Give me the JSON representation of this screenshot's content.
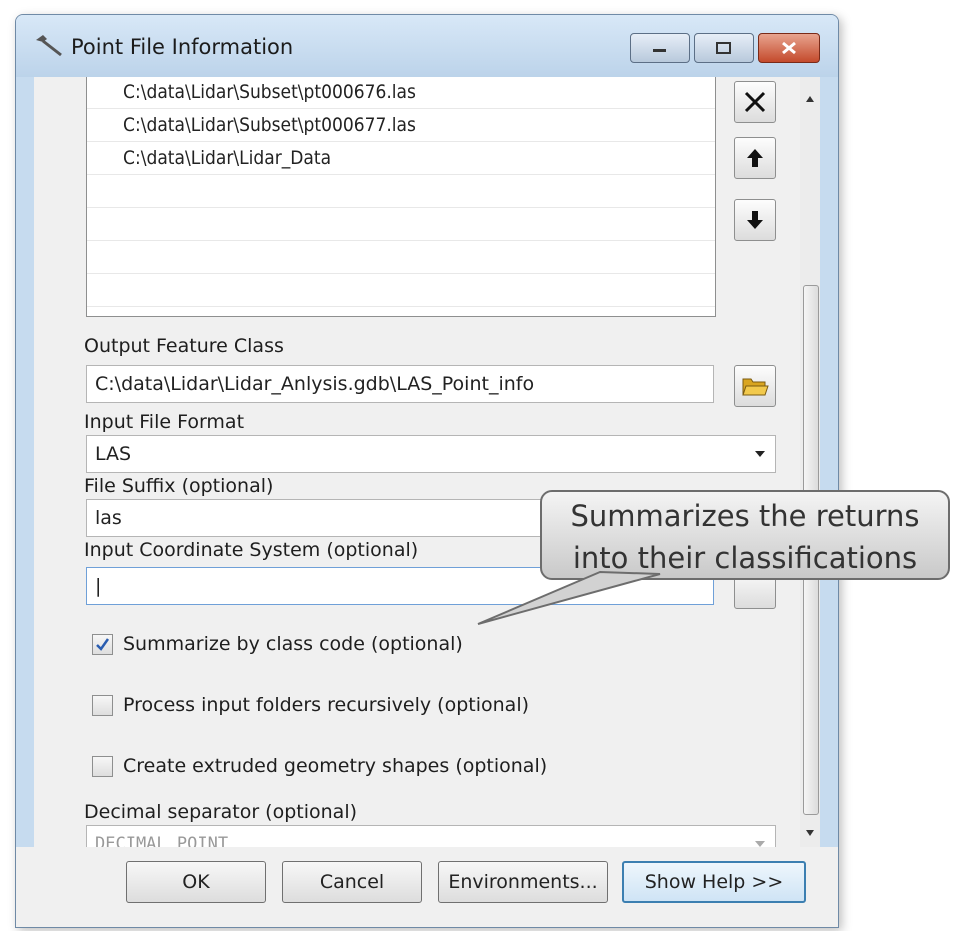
{
  "window": {
    "title": "Point File Information"
  },
  "input_files": {
    "items": [
      "C:\\data\\Lidar\\Subset\\pt000676.las",
      "C:\\data\\Lidar\\Subset\\pt000677.las",
      "C:\\data\\Lidar\\Lidar_Data"
    ]
  },
  "output_feature_class": {
    "label": "Output Feature Class",
    "value": "C:\\data\\Lidar\\Lidar_Anlysis.gdb\\LAS_Point_info"
  },
  "input_file_format": {
    "label": "Input File Format",
    "value": "LAS"
  },
  "file_suffix": {
    "label": "File Suffix (optional)",
    "value": "las"
  },
  "input_coordinate_system": {
    "label": "Input Coordinate System (optional)",
    "value": "|"
  },
  "checkboxes": [
    {
      "label": "Summarize by class code (optional)",
      "checked": true
    },
    {
      "label": "Process input folders recursively (optional)",
      "checked": false
    },
    {
      "label": "Create extruded geometry shapes (optional)",
      "checked": false
    }
  ],
  "decimal_separator": {
    "label": "Decimal separator (optional)",
    "value": "DECIMAL_POINT"
  },
  "buttons": {
    "ok": "OK",
    "cancel": "Cancel",
    "environments": "Environments...",
    "show_help": "Show Help >>"
  },
  "callout": {
    "line1": "Summarizes the returns",
    "line2": "into their classifications"
  },
  "icons": {
    "title": "hammer-icon",
    "remove": "x-icon",
    "up": "arrow-up-icon",
    "down": "arrow-down-icon",
    "browse": "folder-open-icon"
  }
}
